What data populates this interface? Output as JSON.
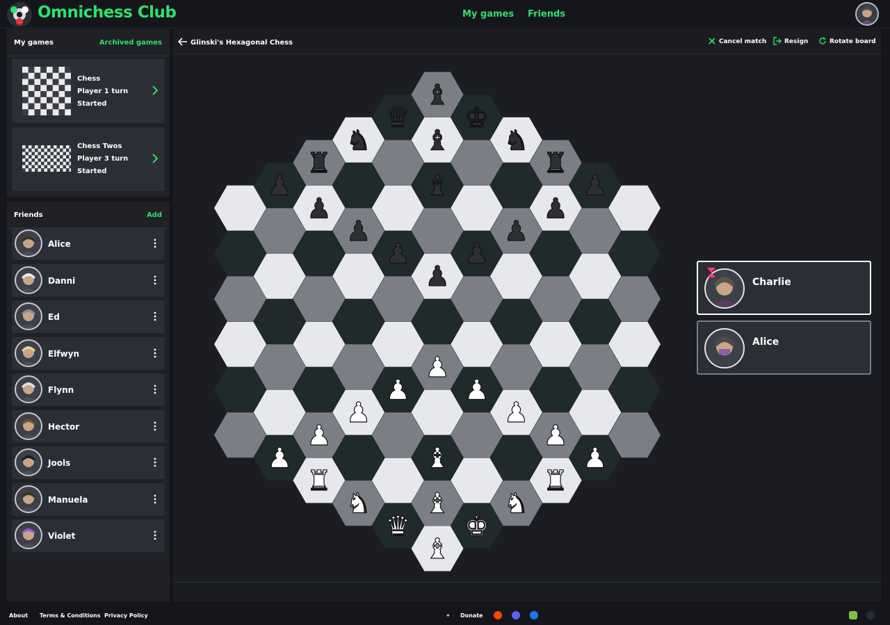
{
  "app": {
    "title": "Omnichess Club",
    "nav": [
      "My games",
      "Friends"
    ]
  },
  "games_panel": {
    "title": "My games",
    "action": "Archived games",
    "games": [
      {
        "name": "Chess",
        "turn": "Player 1 turn",
        "status": "Started"
      },
      {
        "name": "Chess Twos",
        "turn": "Player 3 turn",
        "status": "Started"
      }
    ]
  },
  "friends_panel": {
    "title": "Friends",
    "action": "Add",
    "friends": [
      "Alice",
      "Danni",
      "Ed",
      "Elfwyn",
      "Flynn",
      "Hector",
      "Jools",
      "Manuela",
      "Violet"
    ]
  },
  "match": {
    "title": "Glinski's Hexagonal Chess",
    "actions": [
      "Cancel match",
      "Resign",
      "Rotate board"
    ]
  },
  "players": [
    {
      "name": "Charlie",
      "active": true
    },
    {
      "name": "Alice",
      "active": false
    }
  ],
  "board": {
    "black_pieces": {
      "f11": "bishop",
      "f10": "bishop",
      "f9": "bishop",
      "e10": "queen",
      "g10": "king",
      "d9": "knight",
      "h9": "knight",
      "c8": "rook",
      "i8": "rook",
      "b7": "pawn",
      "c7": "pawn",
      "d7": "pawn",
      "e7": "pawn",
      "f7": "pawn",
      "g7": "pawn",
      "h7": "pawn",
      "i7": "pawn",
      "k7": "pawn"
    },
    "white_pieces": {
      "f1": "bishop",
      "f2": "bishop",
      "f3": "bishop",
      "e1": "queen",
      "g1": "king",
      "d1": "knight",
      "h1": "knight",
      "c1": "rook",
      "i1": "rook",
      "b1": "pawn",
      "c2": "pawn",
      "d3": "pawn",
      "e4": "pawn",
      "f5": "pawn",
      "g4": "pawn",
      "h3": "pawn",
      "i2": "pawn",
      "k1": "pawn"
    }
  },
  "footer": {
    "links": [
      "About",
      "Terms & Conditions",
      "Privacy Policy"
    ],
    "donate": "Donate"
  },
  "colors": {
    "accent": "#2fe06a",
    "hex_light": "#e6e8ec",
    "hex_mid": "#7b7e85",
    "hex_dark": "#1f2a2b"
  }
}
